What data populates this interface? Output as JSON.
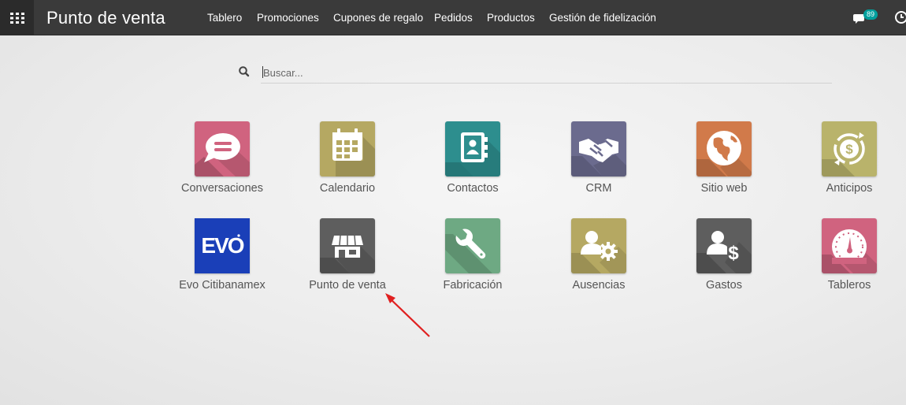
{
  "navbar": {
    "brand": "Punto de venta",
    "menu": [
      "Tablero",
      "Promociones",
      "Cupones de regalo",
      "Pedidos",
      "Productos",
      "Gestión de fidelización"
    ],
    "chat_count": "89",
    "bg_color": "#3a3a3a",
    "badge_color": "#00a09d"
  },
  "search": {
    "placeholder": "Buscar..."
  },
  "apps": [
    {
      "label": "Conversaciones",
      "icon": "chat-bubble-icon",
      "color": "#d0637f"
    },
    {
      "label": "Calendario",
      "icon": "calendar-icon",
      "color": "#b5a862"
    },
    {
      "label": "Contactos",
      "icon": "address-book-icon",
      "color": "#2d8e8e"
    },
    {
      "label": "CRM",
      "icon": "handshake-icon",
      "color": "#6b6b8e"
    },
    {
      "label": "Sitio web",
      "icon": "globe-icon",
      "color": "#d17a4a"
    },
    {
      "label": "Anticipos",
      "icon": "dollar-cycle-icon",
      "color": "#b9b36b"
    },
    {
      "label": "Evo Citibanamex",
      "icon": "evo-logo-icon",
      "color": "#1a3fb8"
    },
    {
      "label": "Punto de venta",
      "icon": "store-icon",
      "color": "#5e5e5e"
    },
    {
      "label": "Fabricación",
      "icon": "wrench-icon",
      "color": "#6ea983"
    },
    {
      "label": "Ausencias",
      "icon": "user-gear-icon",
      "color": "#b5a862"
    },
    {
      "label": "Gastos",
      "icon": "user-dollar-icon",
      "color": "#5e5e5e"
    },
    {
      "label": "Tableros",
      "icon": "gauge-icon",
      "color": "#d0637f"
    }
  ],
  "annotation": {
    "arrow_color": "#e02020"
  }
}
